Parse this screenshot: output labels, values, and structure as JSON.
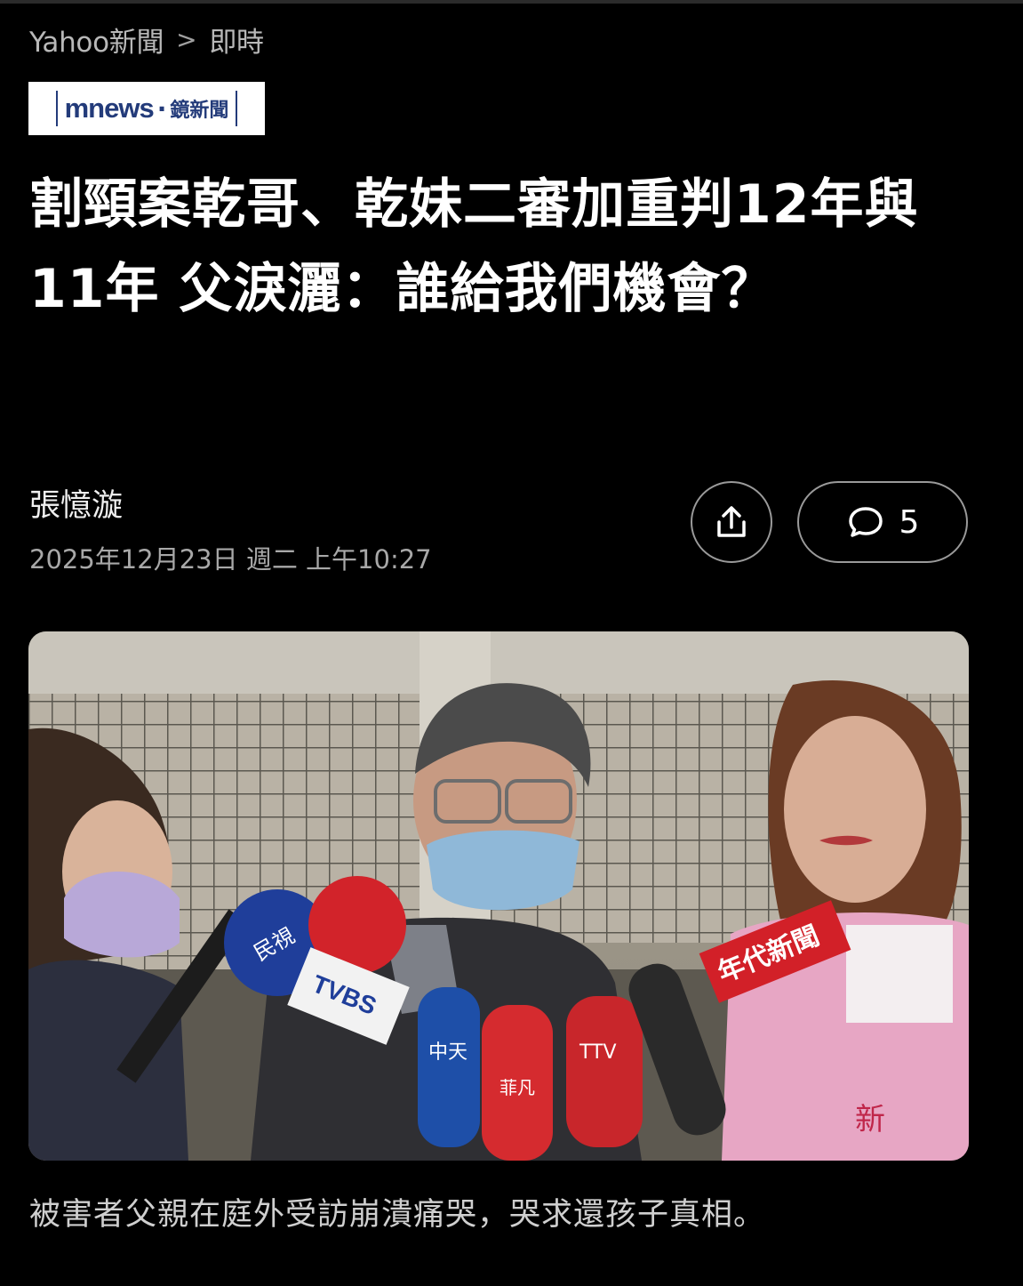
{
  "breadcrumb": {
    "source": "Yahoo新聞",
    "separator": ">",
    "section": "即時"
  },
  "publisher": {
    "brand": "mnews",
    "dot": "·",
    "name_cn": "鏡新聞",
    "color": "#233b7a"
  },
  "article": {
    "headline": "割頸案乾哥、乾妹二審加重判12年與11年 父淚灑：誰給我們機會？",
    "author": "張憶漩",
    "timestamp": "2025年12月23日 週二 上午10:27"
  },
  "actions": {
    "share_icon": "share-upload-icon",
    "comment_icon": "speech-bubble-icon",
    "comment_count": "5"
  },
  "photo": {
    "microphone_labels": [
      "民視",
      "TVBS",
      "中天",
      "菲凡",
      "TTV",
      "年代新聞"
    ],
    "sash_text": "新"
  },
  "caption": "被害者父親在庭外受訪崩潰痛哭，哭求還孩子真相。"
}
